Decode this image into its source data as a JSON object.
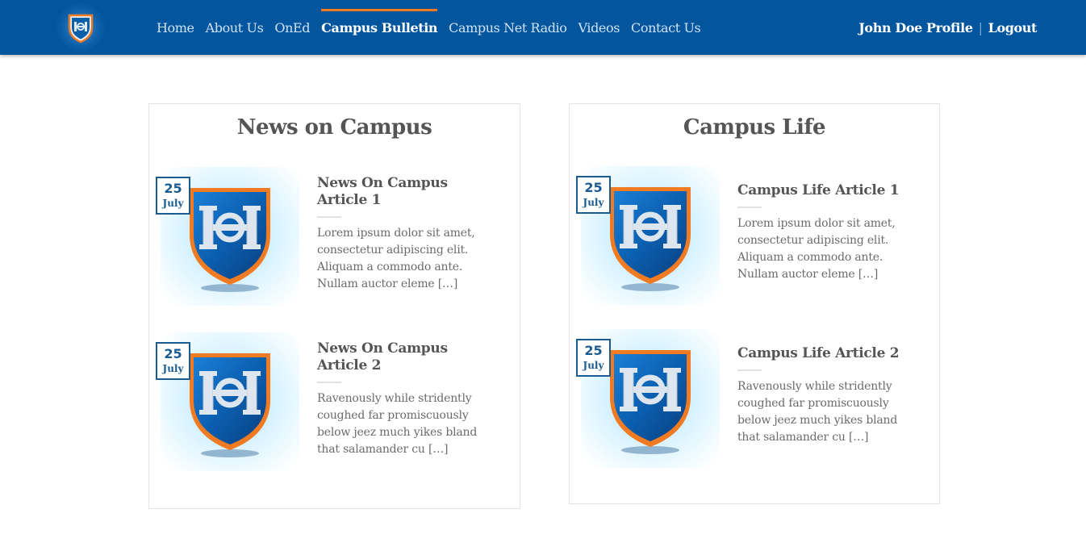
{
  "header": {
    "logo_icon": "shield-logo-icon",
    "nav": [
      {
        "label": "Home"
      },
      {
        "label": "About Us"
      },
      {
        "label": "OnEd"
      },
      {
        "label": "Campus Bulletin",
        "active": true
      },
      {
        "label": "Campus Net Radio"
      },
      {
        "label": "Videos"
      },
      {
        "label": "Contact Us"
      }
    ],
    "user": {
      "profile_label": "John Doe Profile",
      "separator": "|",
      "logout_label": "Logout"
    }
  },
  "colors": {
    "header_bg": "#03569d",
    "accent": "#f07b22",
    "badge_border": "#1a5c92"
  },
  "panels": [
    {
      "title": "News on Campus",
      "articles": [
        {
          "day": "25",
          "month": "July",
          "title": "News On Campus Article 1",
          "excerpt": "Lorem ipsum dolor sit amet, consectetur adipiscing elit. Aliquam a commodo ante. Nullam auctor eleme […]"
        },
        {
          "day": "25",
          "month": "July",
          "title": "News On Campus Article 2",
          "excerpt": "Ravenously while stridently coughed far promiscuously below jeez much yikes bland that salamander cu […]"
        }
      ]
    },
    {
      "title": "Campus Life",
      "articles": [
        {
          "day": "25",
          "month": "July",
          "title": "Campus Life Article 1",
          "excerpt": "Lorem ipsum dolor sit amet, consectetur adipiscing elit. Aliquam a commodo ante. Nullam auctor eleme […]"
        },
        {
          "day": "25",
          "month": "July",
          "title": "Campus Life Article 2",
          "excerpt": "Ravenously while stridently coughed far promiscuously below jeez much yikes bland that salamander cu […]"
        }
      ]
    }
  ]
}
